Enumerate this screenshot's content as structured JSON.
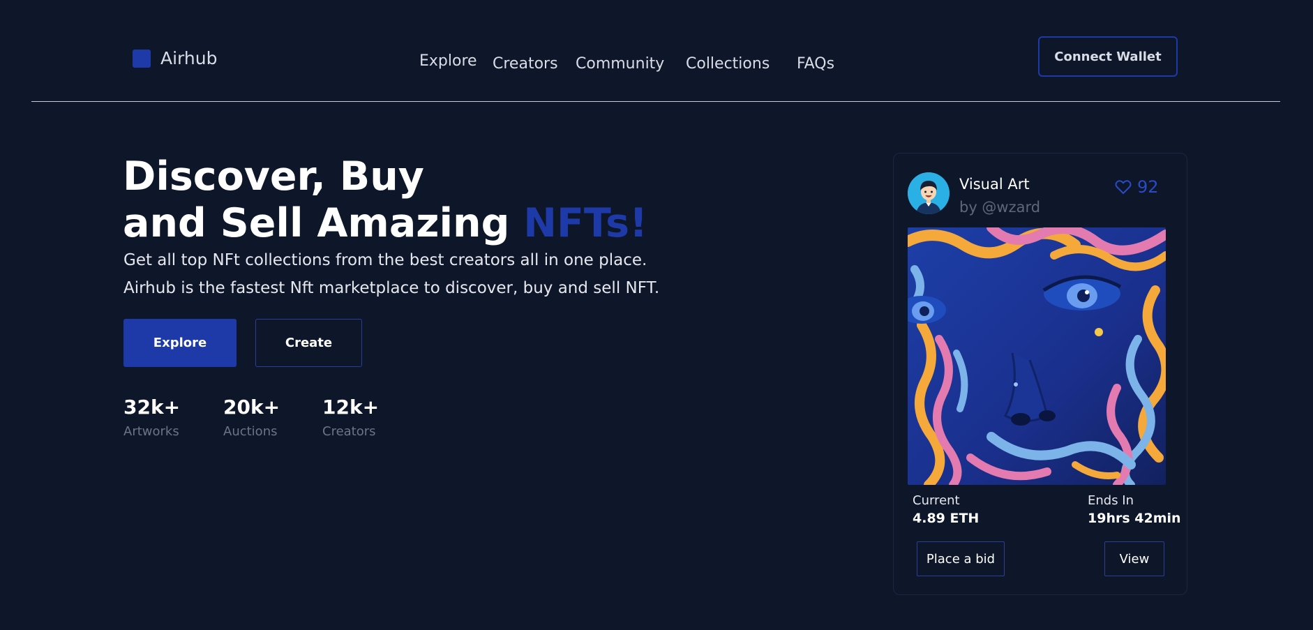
{
  "header": {
    "logo_text": "Airhub",
    "nav": [
      "Explore",
      "Creators",
      "Community",
      "Collections",
      "FAQs"
    ],
    "connect_label": "Connect Wallet"
  },
  "hero": {
    "title_line1": "Discover, Buy",
    "title_line2_prefix": "and Sell Amazing ",
    "title_accent": "NFTs!",
    "desc_line1": "Get all top NFt collections from the best creators all in one place.",
    "desc_line2": "Airhub is the fastest Nft marketplace to discover, buy and sell NFT.",
    "explore_label": "Explore",
    "create_label": "Create",
    "stats": [
      {
        "value": "32k+",
        "label": "Artworks"
      },
      {
        "value": "20k+",
        "label": "Auctions"
      },
      {
        "value": "12k+",
        "label": "Creators"
      }
    ]
  },
  "card": {
    "title": "Visual Art",
    "author": "by @wzard",
    "likes": "92",
    "current_label": "Current",
    "current_value": "4.89 ETH",
    "ends_label": "Ends In",
    "ends_value": "19hrs 42min",
    "bid_label": "Place a bid",
    "view_label": "View"
  },
  "colors": {
    "background": "#0e1629",
    "accent": "#1e3aa9",
    "muted": "#6d7485"
  },
  "icons": {
    "logo": "square-logo-icon",
    "likes": "heart-icon"
  }
}
